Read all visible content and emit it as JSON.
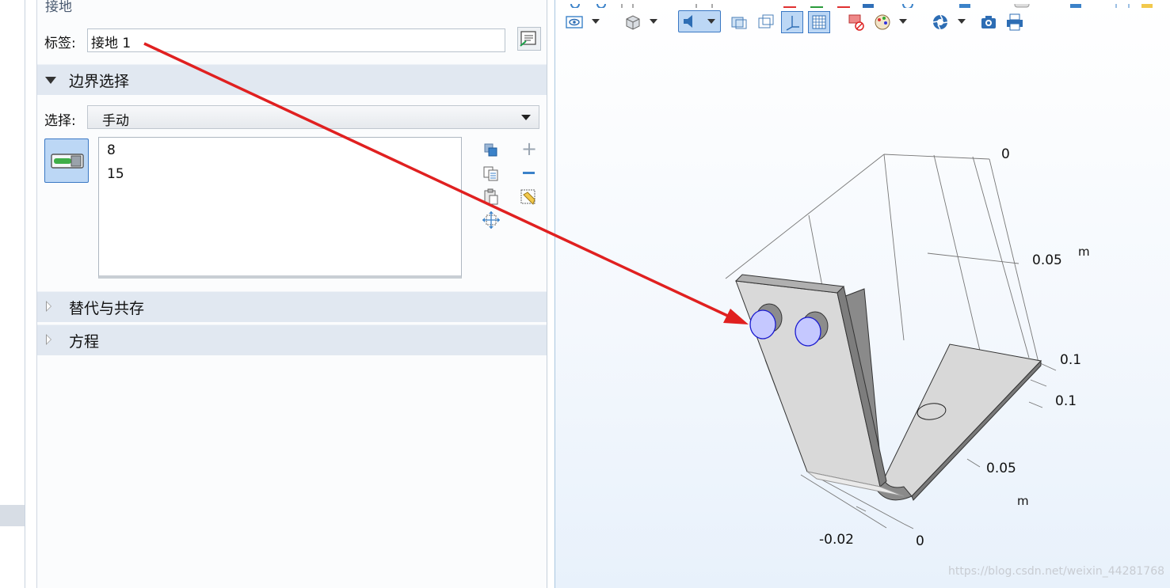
{
  "panel": {
    "title": "接地",
    "label_caption": "标签:",
    "label_value": "接地 1",
    "boundary_section": "边界选择",
    "selection_caption": "选择:",
    "selection_value": "手动",
    "selected_items": [
      "8",
      "15"
    ],
    "collapsed_sections": [
      "替代与共存",
      "方程"
    ]
  },
  "graphics": {
    "axis_labels": {
      "top_zero": "0",
      "z_005": "0.05",
      "z_unit": "m",
      "z_01": "0.1",
      "y_01": "0.1",
      "y_005": "0.05",
      "y_unit": "m",
      "x_neg002": "-0.02",
      "x_zero": "0"
    },
    "watermark": "https://blog.csdn.net/weixin_44281768",
    "accent_color": "#3d7fc8",
    "highlight_color": "#c5c8ff",
    "arrow_color": "#e02020"
  }
}
